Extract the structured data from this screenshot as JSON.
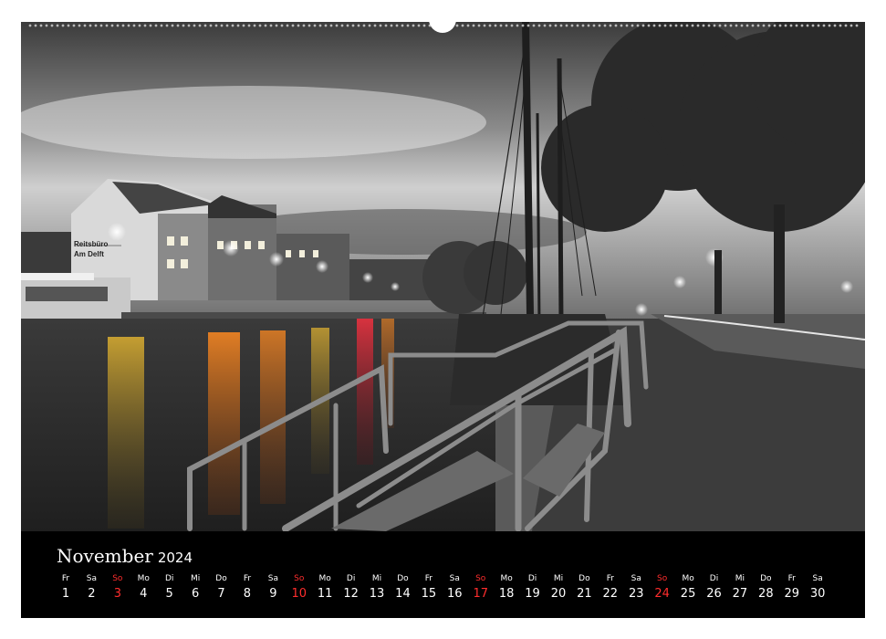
{
  "calendar": {
    "month": "November",
    "year": "2024",
    "sunday_color": "#ff2d2d",
    "days": [
      {
        "wd": "Fr",
        "d": "1"
      },
      {
        "wd": "Sa",
        "d": "2"
      },
      {
        "wd": "So",
        "d": "3"
      },
      {
        "wd": "Mo",
        "d": "4"
      },
      {
        "wd": "Di",
        "d": "5"
      },
      {
        "wd": "Mi",
        "d": "6"
      },
      {
        "wd": "Do",
        "d": "7"
      },
      {
        "wd": "Fr",
        "d": "8"
      },
      {
        "wd": "Sa",
        "d": "9"
      },
      {
        "wd": "So",
        "d": "10"
      },
      {
        "wd": "Mo",
        "d": "11"
      },
      {
        "wd": "Di",
        "d": "12"
      },
      {
        "wd": "Mi",
        "d": "13"
      },
      {
        "wd": "Do",
        "d": "14"
      },
      {
        "wd": "Fr",
        "d": "15"
      },
      {
        "wd": "Sa",
        "d": "16"
      },
      {
        "wd": "So",
        "d": "17"
      },
      {
        "wd": "Mo",
        "d": "18"
      },
      {
        "wd": "Di",
        "d": "19"
      },
      {
        "wd": "Mi",
        "d": "20"
      },
      {
        "wd": "Do",
        "d": "21"
      },
      {
        "wd": "Fr",
        "d": "22"
      },
      {
        "wd": "Sa",
        "d": "23"
      },
      {
        "wd": "So",
        "d": "24"
      },
      {
        "wd": "Mo",
        "d": "25"
      },
      {
        "wd": "Di",
        "d": "26"
      },
      {
        "wd": "Mi",
        "d": "27"
      },
      {
        "wd": "Do",
        "d": "28"
      },
      {
        "wd": "Fr",
        "d": "29"
      },
      {
        "wd": "Sa",
        "d": "30"
      }
    ]
  },
  "photo": {
    "signs": [
      "Reitsbüro",
      "Am Delft"
    ]
  }
}
